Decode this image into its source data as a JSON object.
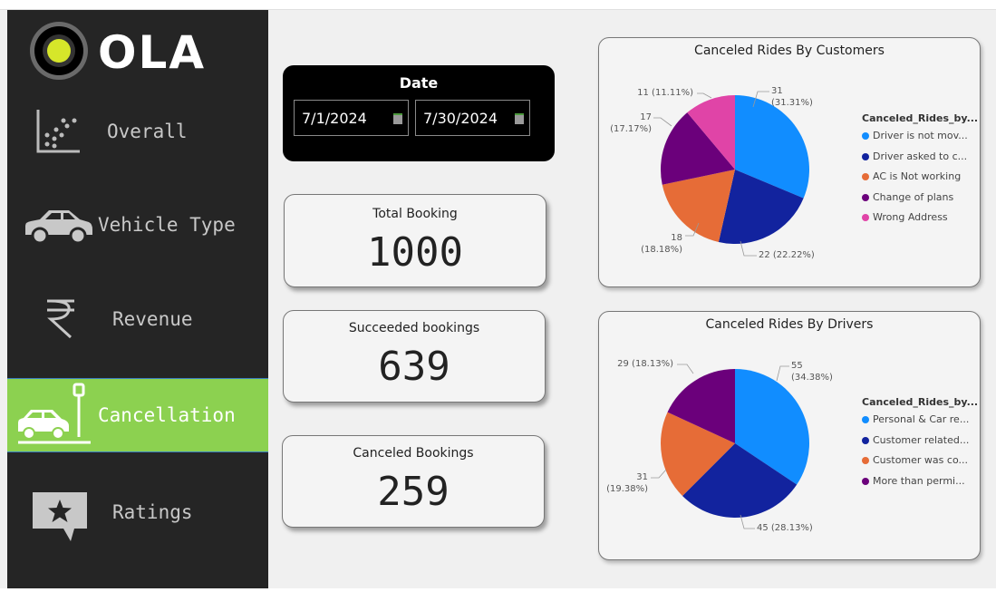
{
  "brand": {
    "name": "OLA",
    "accent": "#8cd150",
    "sidebar_bg": "#252525"
  },
  "nav": [
    {
      "label": "Overall",
      "icon": "scatter-chart-icon"
    },
    {
      "label": "Vehicle Type",
      "icon": "car-icon"
    },
    {
      "label": "Revenue",
      "icon": "rupee-icon"
    },
    {
      "label": "Cancellation",
      "icon": "parked-car-icon",
      "active": true
    },
    {
      "label": "Ratings",
      "icon": "star-comment-icon"
    }
  ],
  "date_filter": {
    "title": "Date",
    "start": "7/1/2024",
    "end": "7/30/2024"
  },
  "kpis": [
    {
      "title": "Total Booking",
      "value": "1000"
    },
    {
      "title": "Succeeded bookings",
      "value": "639"
    },
    {
      "title": "Canceled Bookings",
      "value": "259"
    }
  ],
  "chart_data": [
    {
      "type": "pie",
      "title": "Canceled Rides By Customers",
      "legend_title": "Canceled_Rides_by...",
      "legend_placement": "right",
      "slices": [
        {
          "label": "Driver is not mov...",
          "value": 31,
          "pct": "31.31%",
          "color": "#118dff",
          "data_label_a": "31",
          "data_label_b": "(31.31%)"
        },
        {
          "label": "Driver asked to c...",
          "value": 22,
          "pct": "22.22%",
          "color": "#12239e",
          "data_label_a": "22 (22.22%)",
          "data_label_b": ""
        },
        {
          "label": "AC is Not working",
          "value": 18,
          "pct": "18.18%",
          "color": "#e66c37",
          "data_label_a": "18",
          "data_label_b": "(18.18%)"
        },
        {
          "label": "Change of plans",
          "value": 17,
          "pct": "17.17%",
          "color": "#6b007b",
          "data_label_a": "17",
          "data_label_b": "(17.17%)"
        },
        {
          "label": "Wrong Address",
          "value": 11,
          "pct": "11.11%",
          "color": "#e044a7",
          "data_label_a": "11 (11.11%)",
          "data_label_b": ""
        }
      ]
    },
    {
      "type": "pie",
      "title": "Canceled Rides By Drivers",
      "legend_title": "Canceled_Rides_by...",
      "legend_placement": "right",
      "slices": [
        {
          "label": "Personal & Car re...",
          "value": 55,
          "pct": "34.38%",
          "color": "#118dff",
          "data_label_a": "55",
          "data_label_b": "(34.38%)"
        },
        {
          "label": "Customer related...",
          "value": 45,
          "pct": "28.13%",
          "color": "#12239e",
          "data_label_a": "45 (28.13%)",
          "data_label_b": ""
        },
        {
          "label": "Customer was co...",
          "value": 31,
          "pct": "19.38%",
          "color": "#e66c37",
          "data_label_a": "31",
          "data_label_b": "(19.38%)"
        },
        {
          "label": "More than permi...",
          "value": 29,
          "pct": "18.13%",
          "color": "#6b007b",
          "data_label_a": "29 (18.13%)",
          "data_label_b": ""
        }
      ]
    }
  ]
}
